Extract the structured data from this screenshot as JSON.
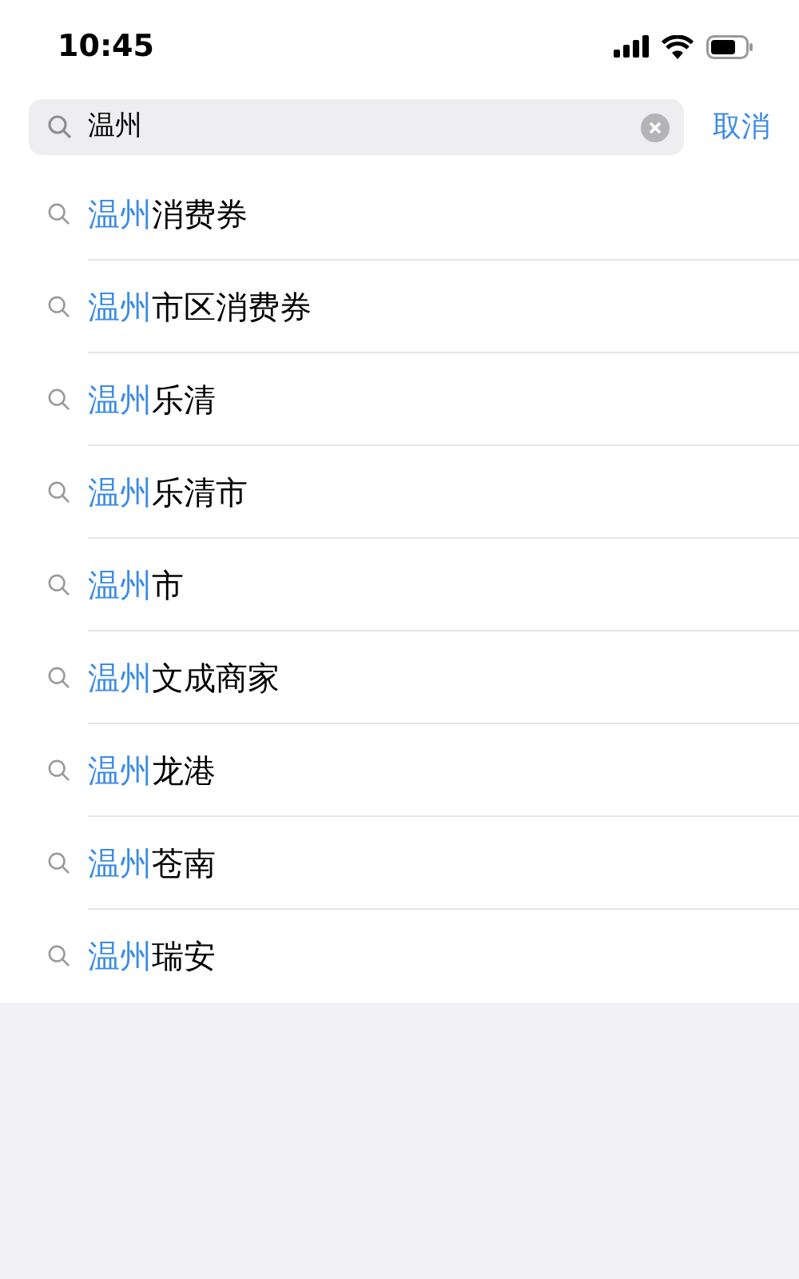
{
  "status_bar": {
    "time": "10:45"
  },
  "search": {
    "value": "温州",
    "cancel": "取消"
  },
  "suggestions": [
    {
      "match": "温州",
      "rest": "消费券"
    },
    {
      "match": "温州",
      "rest": "市区消费券"
    },
    {
      "match": "温州",
      "rest": "乐清"
    },
    {
      "match": "温州",
      "rest": "乐清市"
    },
    {
      "match": "温州",
      "rest": "市"
    },
    {
      "match": "温州",
      "rest": "文成商家"
    },
    {
      "match": "温州",
      "rest": "龙港"
    },
    {
      "match": "温州",
      "rest": "苍南"
    },
    {
      "match": "温州",
      "rest": "瑞安"
    }
  ]
}
